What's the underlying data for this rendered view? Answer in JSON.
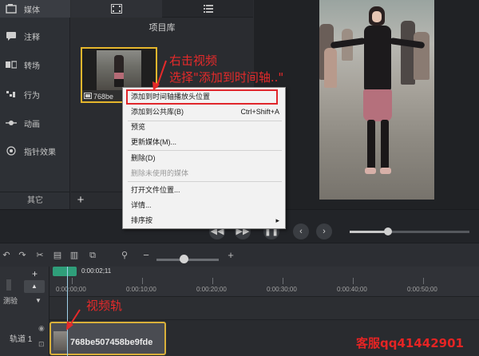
{
  "sidebar": {
    "items": [
      {
        "label": "媒体",
        "icon": "media-icon"
      },
      {
        "label": "注释",
        "icon": "annotation-icon"
      },
      {
        "label": "转场",
        "icon": "transition-icon"
      },
      {
        "label": "行为",
        "icon": "behavior-icon"
      },
      {
        "label": "动画",
        "icon": "animation-icon"
      },
      {
        "label": "指针效果",
        "icon": "cursor-effect-icon"
      }
    ],
    "more_label": "其它"
  },
  "bin": {
    "title": "项目库",
    "media_name": "768be"
  },
  "context_menu": {
    "items": [
      {
        "label": "添加到时间轴播放头位置",
        "shortcut": "",
        "enabled": true,
        "highlighted": true
      },
      {
        "label": "添加到公共库(B)",
        "shortcut": "Ctrl+Shift+A",
        "enabled": true
      },
      {
        "label": "预览",
        "shortcut": "",
        "enabled": true
      },
      {
        "label": "更新媒体(M)...",
        "shortcut": "",
        "enabled": true
      },
      {
        "label": "删除(D)",
        "shortcut": "",
        "enabled": true
      },
      {
        "label": "删除未使用的媒体",
        "shortcut": "",
        "enabled": false
      },
      {
        "label": "打开文件位置...",
        "shortcut": "",
        "enabled": true
      },
      {
        "label": "详情...",
        "shortcut": "",
        "enabled": true
      },
      {
        "label": "排序按",
        "shortcut": "▸",
        "enabled": true
      }
    ]
  },
  "timeline": {
    "playhead_time": "0:00:02;11",
    "ruler_labels": [
      "0:00:00;00",
      "0:00:10;00",
      "0:00:20;00",
      "0:00:30;00",
      "0:00:40;00",
      "0:00:50;00"
    ],
    "group_label": "测验",
    "track_label": "轨道 1",
    "clip_name": "768be507458be9fde",
    "scrub_progress": 0.32,
    "zoom_level": 0.44
  },
  "annotations": {
    "right_click_line1": "右击视频",
    "right_click_line2": "选择\"添加到时间轴..\"",
    "track_note": "视频轨",
    "watermark": "客服qq41442901"
  },
  "colors": {
    "accent_selection": "#e5b62c",
    "annotation_red": "#e52a2a",
    "playhead_green": "#2f9e7a"
  }
}
